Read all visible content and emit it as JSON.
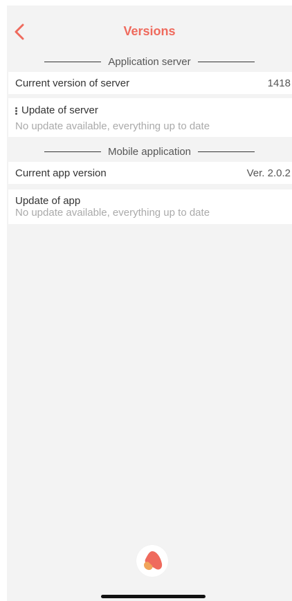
{
  "header": {
    "title": "Versions",
    "back_icon": "chevron-left-icon"
  },
  "sections": [
    {
      "title": "Application server",
      "current": {
        "label": "Current version of server",
        "value": "1418"
      },
      "update": {
        "label": "Update of server",
        "status": "No update available, everything up to date",
        "icon": "kebab-icon"
      }
    },
    {
      "title": "Mobile application",
      "current": {
        "label": "Current app version",
        "value": "Ver. 2.0.2"
      },
      "update": {
        "label": "Update of app",
        "status": "No update available, everything up to date"
      }
    }
  ],
  "colors": {
    "accent": "#ef6a5d",
    "background": "#f3f3f3",
    "card": "#ffffff"
  },
  "footer": {
    "logo_icon": "app-logo-icon"
  }
}
